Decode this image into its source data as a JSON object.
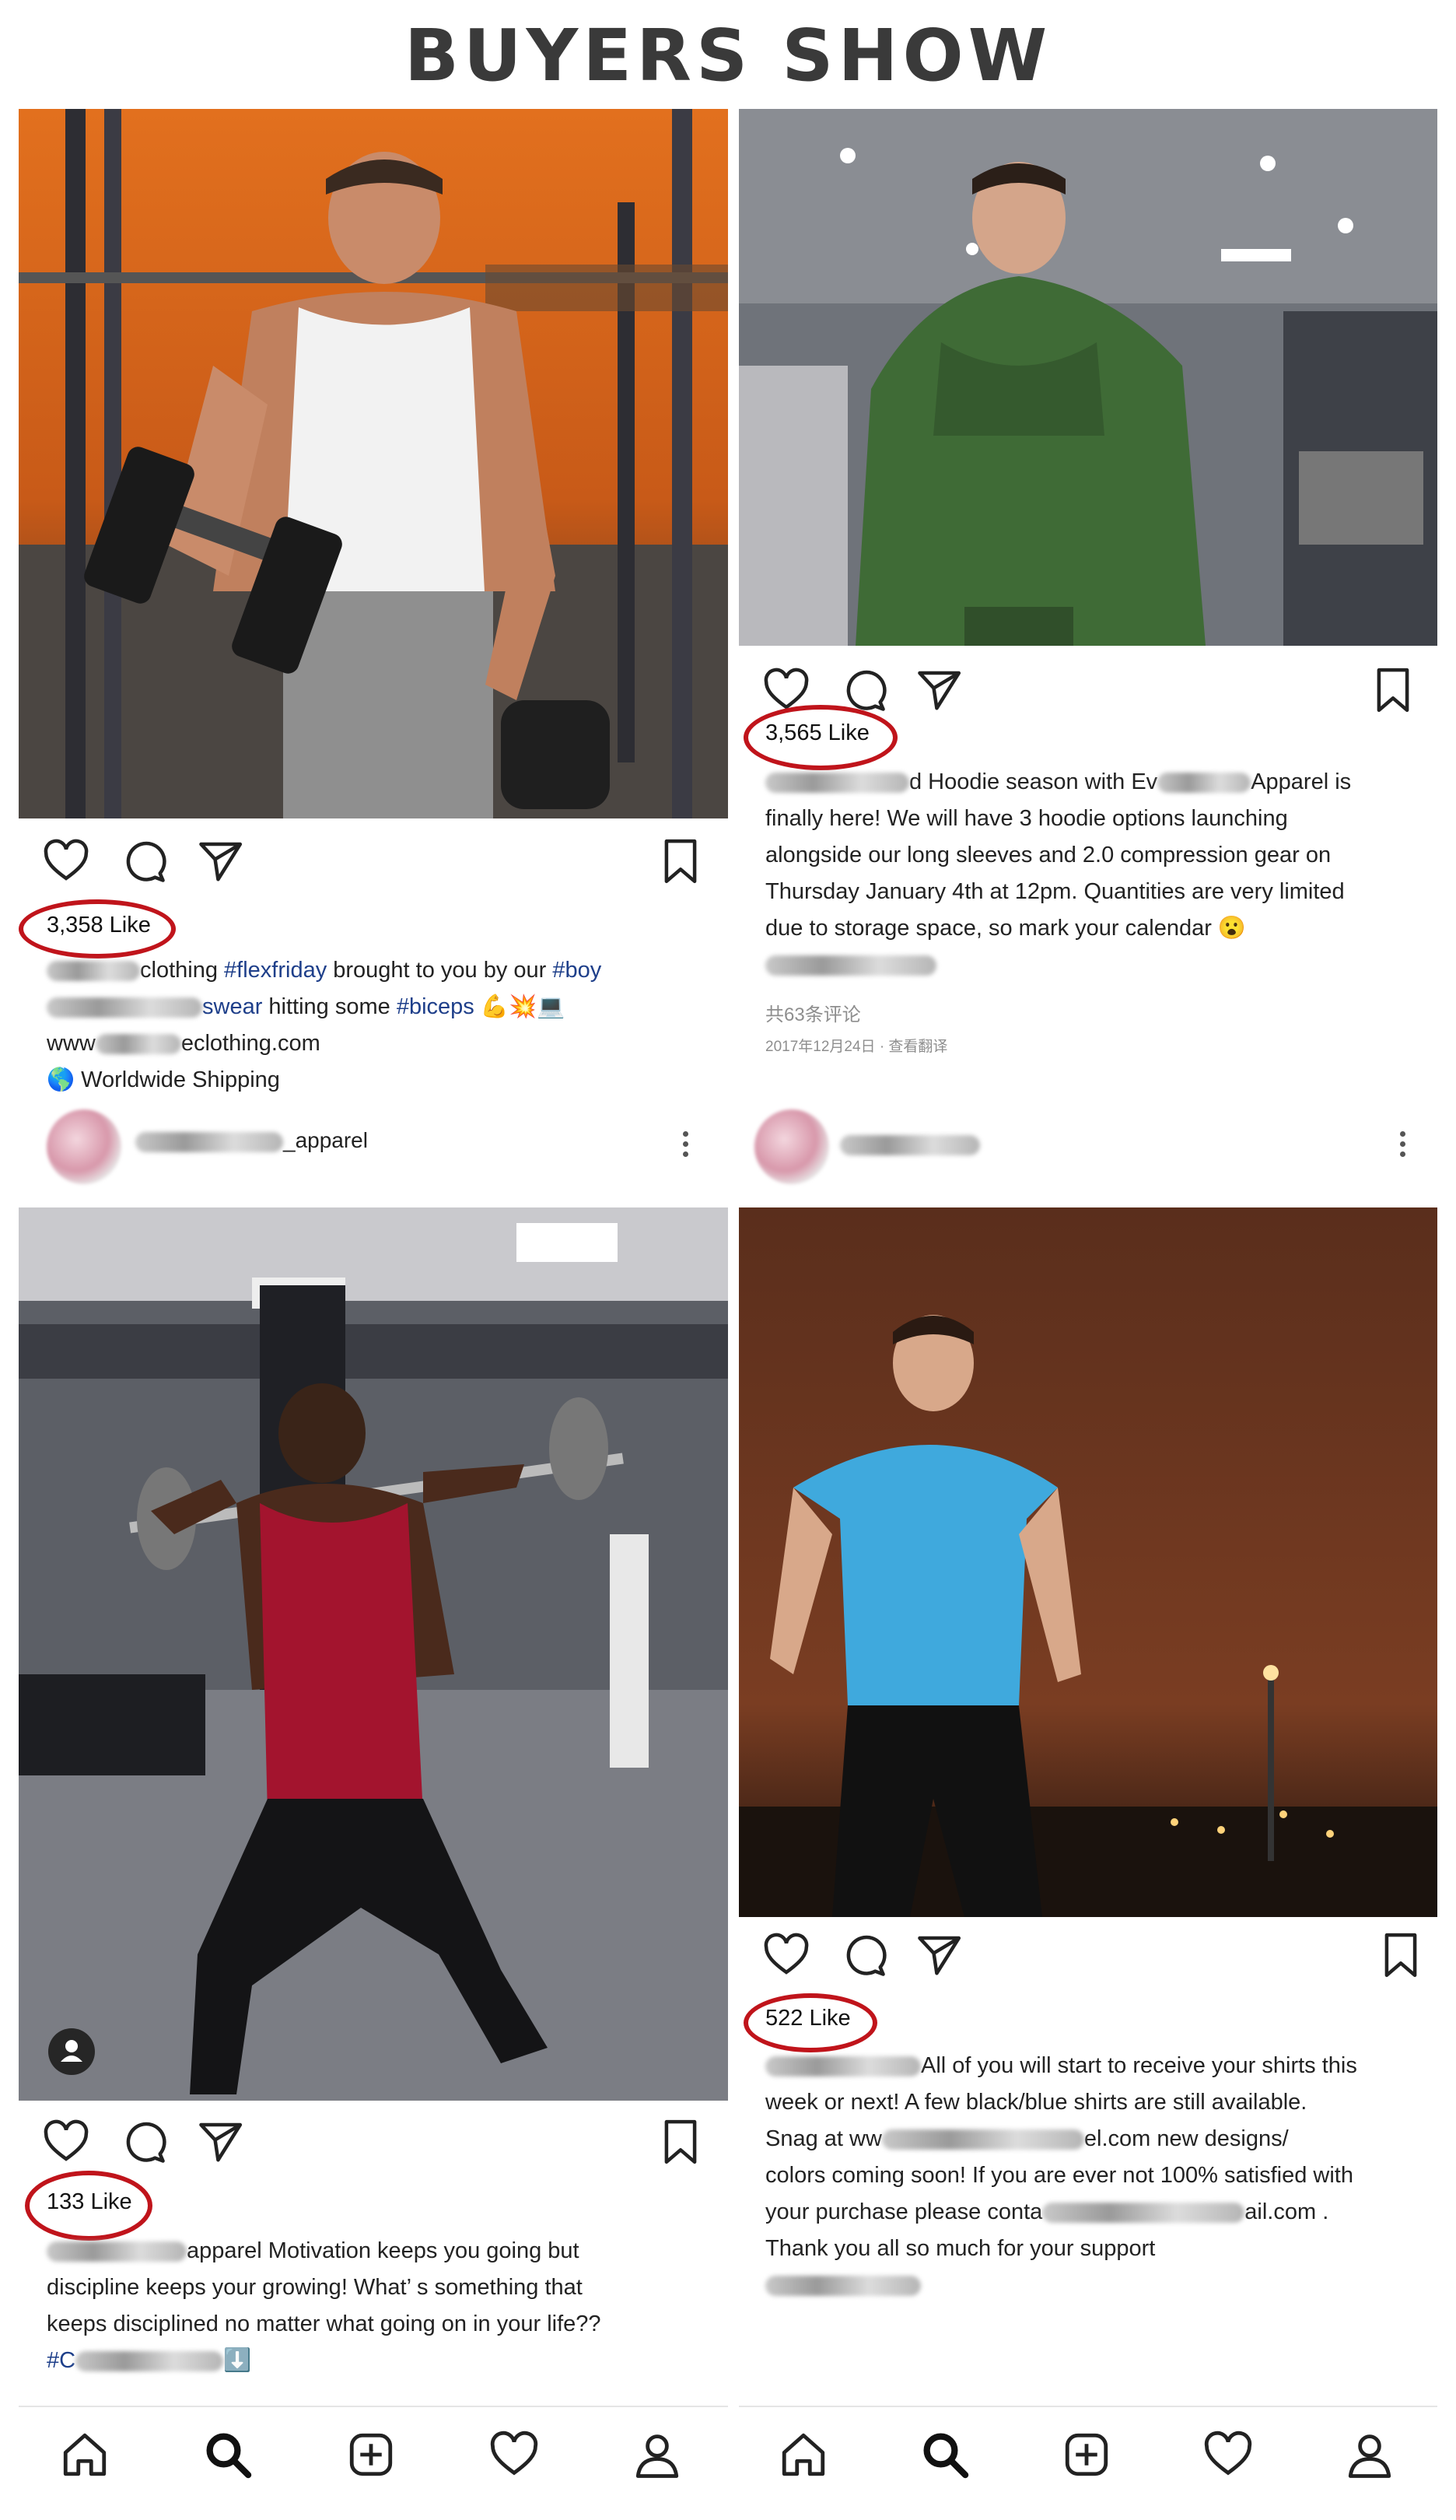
{
  "title": "BUYERS SHOW",
  "posts": {
    "top_left": {
      "likes": "3,358 Like",
      "caption": {
        "handle_suffix": "clothing",
        "tag1": "#flexfriday",
        "text1": " brought to you by our ",
        "tag2": "#boy",
        "handle2_suffix": "swear",
        "text2": " hitting some ",
        "tag3": "#biceps",
        "emoji": "💪💥💻",
        "www_prefix": "www",
        "www_suffix": "eclothing.com",
        "shipping": "🌎 Worldwide Shipping"
      }
    },
    "top_right": {
      "likes": "3,565 Like",
      "caption": {
        "line1_mid": "d Hoodie season with Ev",
        "line1_end": "Apparel is",
        "line2": "finally here! We will have 3 hoodie options launching",
        "line3": "alongside our long sleeves and 2.0 compression gear on",
        "line4": "Thursday January 4th at 12pm. Quantities are very limited",
        "line5": "due to storage space, so mark your calendar 😮"
      },
      "comments": "共63条评论",
      "date": "2017年12月24日 · 查看翻译"
    },
    "bottom_left": {
      "username": "_apparel",
      "likes": "133 Like",
      "caption": {
        "line1_end": "apparel Motivation keeps you going but",
        "line2": "discipline keeps your growing! What’ s something that",
        "line3": "keeps disciplined no matter what going on in your life??",
        "line4_start": "#C",
        "line4_end": "⬇️"
      }
    },
    "bottom_right": {
      "likes": "522 Like",
      "caption": {
        "line1_end": "All of you will start to receive your shirts this",
        "line2": "week or next! A few black/blue shirts are still available.",
        "line3_start": "Snag at ww",
        "line3_end": "el.com new designs/",
        "line4": "colors coming soon! If you are ever not 100% satisfied with",
        "line5_start": "your purchase please conta",
        "line5_end": "ail.com .",
        "line6": "Thank you all so much for your support"
      }
    }
  },
  "icons": {
    "like": "heart-icon",
    "comment": "comment-icon",
    "share": "send-icon",
    "save": "bookmark-icon",
    "tabs": [
      "home-icon",
      "search-icon",
      "add-icon",
      "activity-heart-icon",
      "profile-icon"
    ]
  },
  "colors": {
    "highlight_ring": "#c0141b",
    "hashtag": "#1e3f8a"
  }
}
